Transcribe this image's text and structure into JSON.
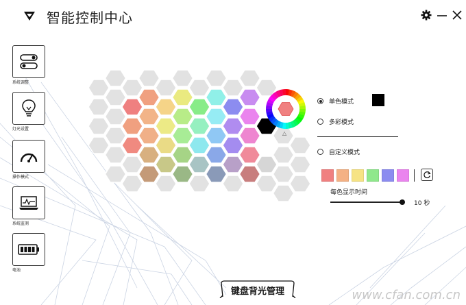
{
  "app": {
    "title": "智能控制中心"
  },
  "window": {
    "icons": [
      "gear-icon",
      "minimize-icon",
      "close-icon"
    ]
  },
  "sidebar": {
    "items": [
      {
        "label": "系统调整",
        "icon": "toggle-switches-icon"
      },
      {
        "label": "灯光设置",
        "icon": "lightbulb-icon",
        "active": true
      },
      {
        "label": "操作模式",
        "icon": "speedometer-icon"
      },
      {
        "label": "系统监测",
        "icon": "laptop-monitor-icon"
      },
      {
        "label": "电池",
        "icon": "battery-icon"
      }
    ]
  },
  "lighting": {
    "modes": [
      {
        "label": "单色模式",
        "selected": true
      },
      {
        "label": "多彩模式",
        "selected": false
      },
      {
        "label": "自定义模式",
        "selected": false
      }
    ],
    "single_color": "#000000",
    "palette": [
      "#f08080",
      "#f4b184",
      "#f6e384",
      "#8fe88c",
      "#8c8cf0",
      "#ea84ee"
    ],
    "interval_label": "每色显示时间",
    "interval_value": "10 秒",
    "interval_fraction": 1.0,
    "wheel_selected_color": "#f08080"
  },
  "bottom": {
    "label": "键盘背光管理"
  },
  "watermark": "www.cfan.com.cn"
}
